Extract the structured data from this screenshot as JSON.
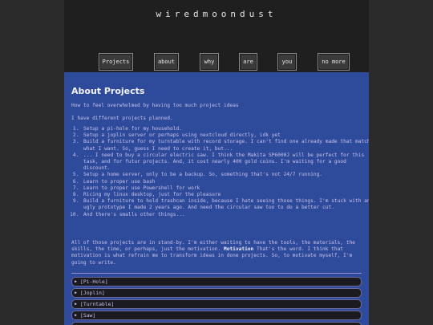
{
  "site": {
    "title": "wiredmoondust"
  },
  "nav": [
    {
      "label": "Projects"
    },
    {
      "label": "about"
    },
    {
      "label": "why"
    },
    {
      "label": "are"
    },
    {
      "label": "you"
    },
    {
      "label": "no more"
    }
  ],
  "page": {
    "title": "About Projects",
    "intro1": "How to feel overwhelmed by having too much project ideas",
    "intro2": "I have different projects planned.",
    "list": [
      "Setup a pi-hole for my household.",
      "Setup a joplin server or perhaps using nextcloud directly, idk yet",
      "Build a furniture for my turntable with record storage. I can't find one already made that match what I want. So, guess I need to create it, but...",
      "... I need to buy a circular electric saw. I think the Makita SP6000J will be perfect for this task, and for futur projects. And, it cost nearly 400 gold coins. I'm waiting for a good discount.",
      "Setup a home server, only to be a backup. So, something that's not 24/7 running.",
      "Learn to proper use bash",
      "Learn to proper use Powershell for work",
      "Ricing my linux desktop, just for the pleasure",
      "Build a furniture to hold trashcan inside, because I hate seeing those things. I'm stuck with an ugly prototype I made 2 years ago. And need the circular saw too to do a better cut.",
      "And there's smalls other things..."
    ],
    "para_before": "All of those projects are in stand-by. I'm either waiting to have the tools, the materials, the skills, the time, or perhaps, just the motivation.",
    "para_bold": "Motivation",
    "para_after": "That's the word. I think that motivation is what refrain me to transform ideas in done projects. So, to motivate myself, I'm going to write.",
    "accordions": [
      {
        "arrow": "▶",
        "label": "[Pi-Hole]"
      },
      {
        "arrow": "▶",
        "label": "[Joplin]"
      },
      {
        "arrow": "▶",
        "label": "[Turntable]"
      },
      {
        "arrow": "▶",
        "label": "[Saw]"
      }
    ]
  }
}
